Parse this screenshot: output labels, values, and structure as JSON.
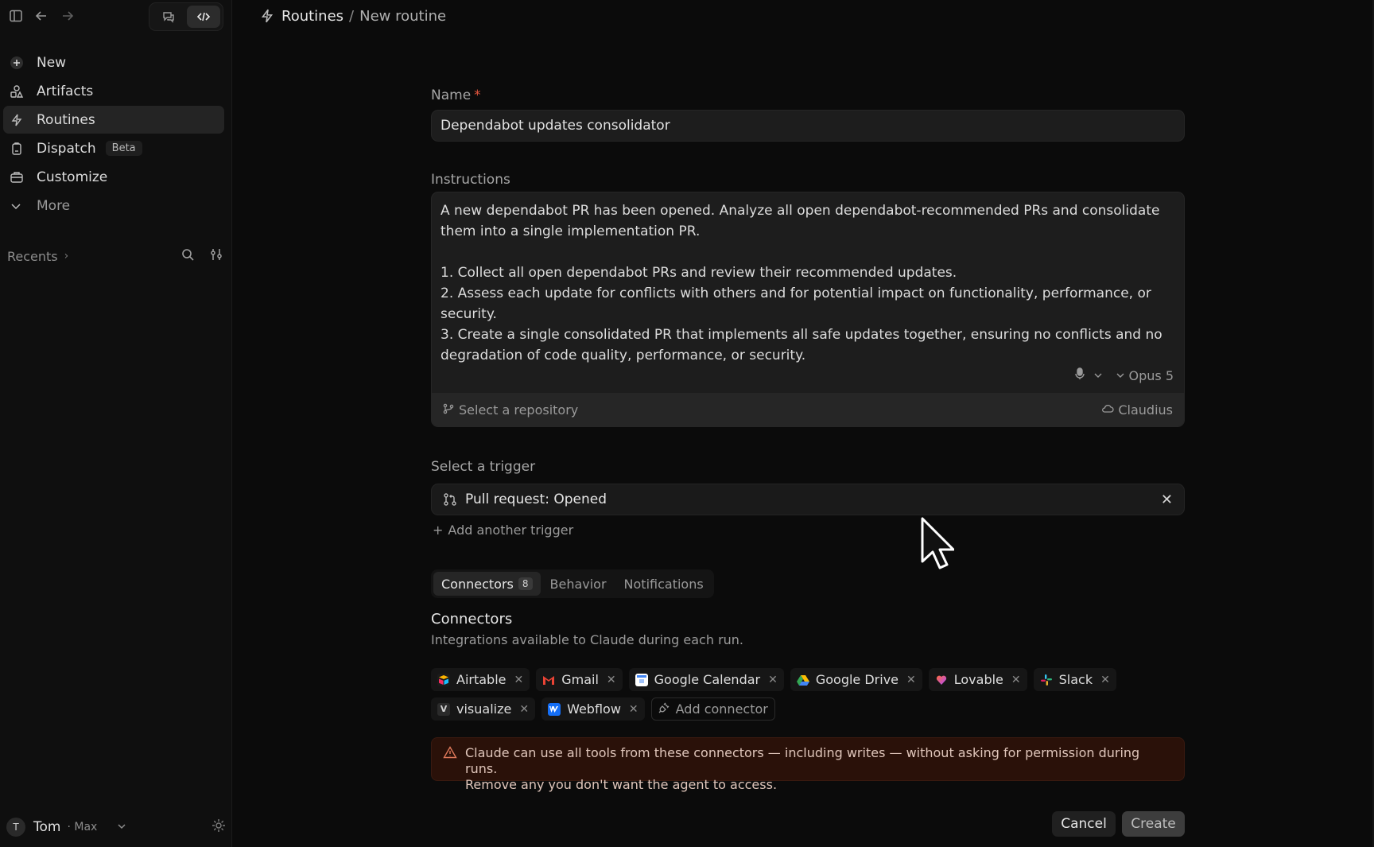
{
  "sidebar": {
    "icons": [
      "sidebar-toggle-icon",
      "back-arrow-icon",
      "forward-arrow-icon",
      "chat-icon",
      "code-icon"
    ],
    "nav": [
      {
        "label": "New",
        "icon": "plus-icon"
      },
      {
        "label": "Artifacts",
        "icon": "shapes-icon"
      },
      {
        "label": "Routines",
        "icon": "bolt-icon",
        "active": true
      },
      {
        "label": "Dispatch",
        "icon": "clipboard-icon",
        "badge": "Beta"
      },
      {
        "label": "Customize",
        "icon": "briefcase-icon"
      },
      {
        "label": "More",
        "icon": "chevron-down-icon"
      }
    ],
    "recents": {
      "label": "Recents",
      "icons": [
        "search-icon",
        "filter-icon"
      ]
    },
    "user": {
      "initial": "T",
      "name": "Tom",
      "plan": "· Max"
    }
  },
  "header": {
    "section": "Routines",
    "separator": "/",
    "page": "New routine"
  },
  "form": {
    "name_label": "Name",
    "required_mark": "*",
    "name_value": "Dependabot updates consolidator",
    "instructions_label": "Instructions",
    "instructions": {
      "intro": "A new dependabot PR has been opened. Analyze all open dependabot-recommended PRs and consolidate them into a single implementation PR.",
      "step1": "1. Collect all open dependabot PRs and review their recommended updates.",
      "step2": "2. Assess each update for conflicts with others and for potential impact on functionality, performance, or security.",
      "step3": "3. Create a single consolidated PR that implements all safe updates together, ensuring no conflicts and no degradation of code quality, performance, or security."
    },
    "model": "Opus 5",
    "repo_placeholder": "Select a repository",
    "environment": "Claudius",
    "trigger_label": "Select a trigger",
    "trigger_value": "Pull request: Opened",
    "add_trigger": "Add another trigger"
  },
  "tabs": [
    {
      "label": "Connectors",
      "count": "8",
      "active": true
    },
    {
      "label": "Behavior"
    },
    {
      "label": "Notifications"
    }
  ],
  "connectors": {
    "title": "Connectors",
    "subtitle": "Integrations available to Claude during each run.",
    "items": [
      {
        "name": "Airtable",
        "color": "#f2b705"
      },
      {
        "name": "Gmail",
        "color": "#ea4335"
      },
      {
        "name": "Google Calendar",
        "color": "#4285f4"
      },
      {
        "name": "Google Drive",
        "color": "#34a853"
      },
      {
        "name": "Lovable",
        "color": "#e8407a"
      },
      {
        "name": "Slack",
        "color": "#4a154b"
      },
      {
        "name": "visualize",
        "color": "#3a3a3a"
      },
      {
        "name": "Webflow",
        "color": "#146ef5"
      }
    ],
    "add_label": "Add connector"
  },
  "warning": {
    "line1": "Claude can use all tools from these connectors — including writes — without asking for permission during runs.",
    "line2": "Remove any you don't want the agent to access."
  },
  "actions": {
    "cancel": "Cancel",
    "create": "Create"
  }
}
